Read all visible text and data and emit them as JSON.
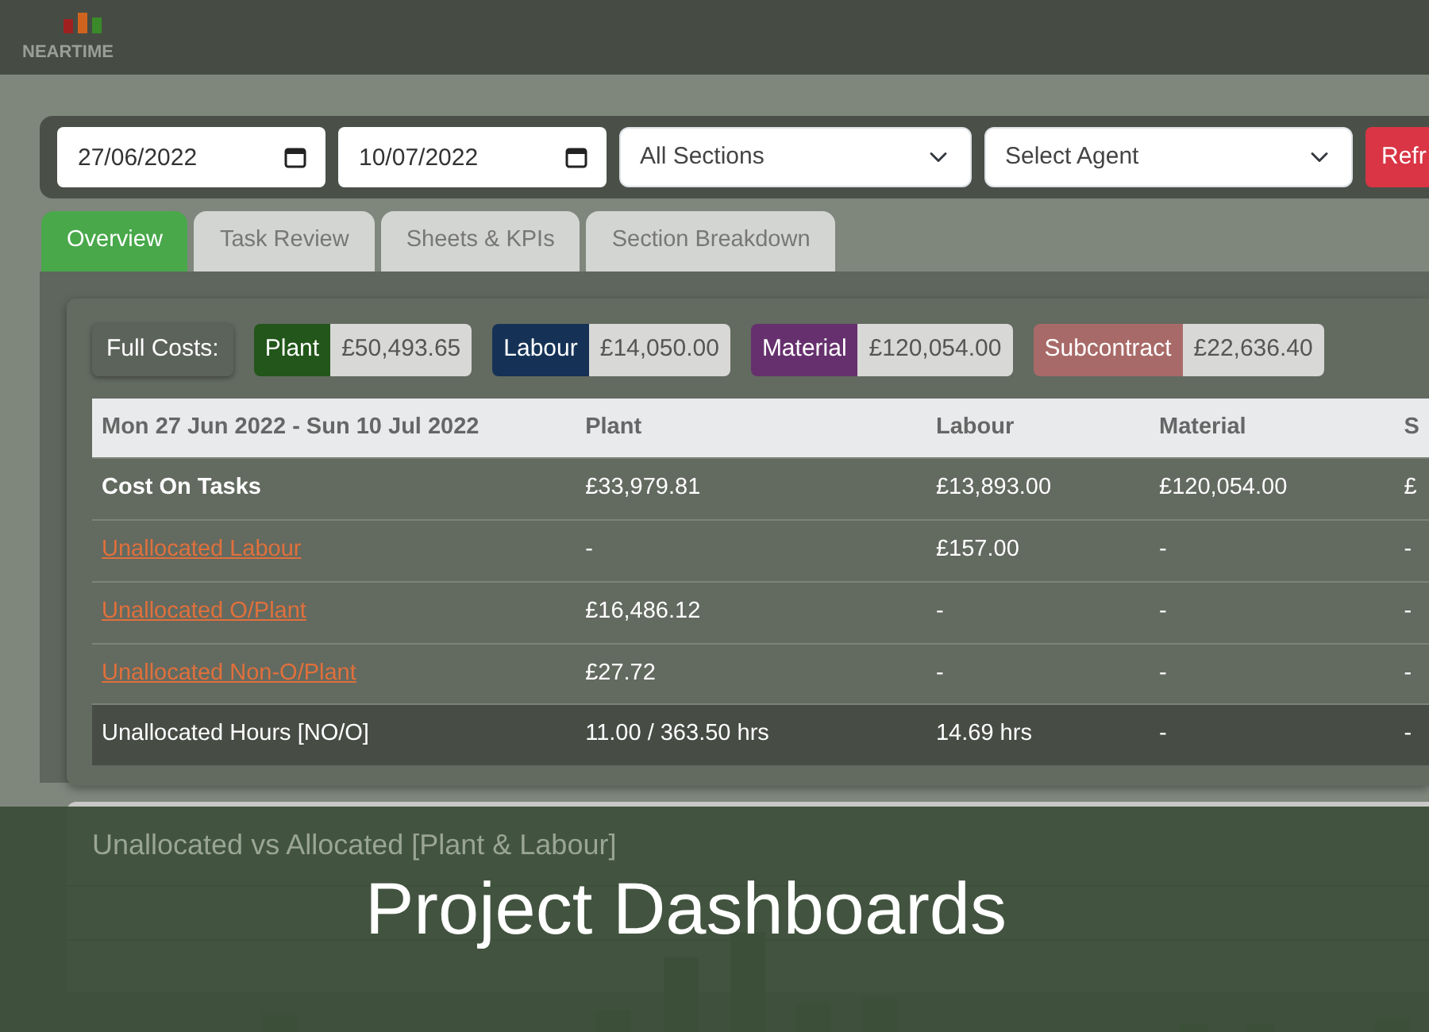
{
  "header": {
    "logo_text": "NEARTIME"
  },
  "filters": {
    "date_from": "27/06/2022",
    "date_to": "10/07/2022",
    "section": "All Sections",
    "agent": "Select Agent",
    "refresh_button": "Refr"
  },
  "tabs": [
    {
      "label": "Overview",
      "selected": true
    },
    {
      "label": "Task Review",
      "selected": false
    },
    {
      "label": "Sheets & KPIs",
      "selected": false
    },
    {
      "label": "Section Breakdown",
      "selected": false
    }
  ],
  "full_costs": {
    "label": "Full Costs:",
    "items": [
      {
        "name": "Plant",
        "amount": "£50,493.65",
        "color": "#22561a"
      },
      {
        "name": "Labour",
        "amount": "£14,050.00",
        "color": "#153256"
      },
      {
        "name": "Material",
        "amount": "£120,054.00",
        "color": "#66306e"
      },
      {
        "name": "Subcontract",
        "amount": "£22,636.40",
        "color": "#a86a68"
      }
    ]
  },
  "table": {
    "columns": [
      "Mon 27 Jun 2022 - Sun 10 Jul 2022",
      "Plant",
      "Labour",
      "Material",
      "S"
    ],
    "rows": [
      {
        "kind": "total",
        "cells": [
          "Cost On Tasks",
          "£33,979.81",
          "£13,893.00",
          "£120,054.00",
          "£"
        ]
      },
      {
        "kind": "link",
        "cells": [
          "Unallocated Labour",
          "-",
          "£157.00",
          "-",
          "-"
        ]
      },
      {
        "kind": "link",
        "cells": [
          "Unallocated O/Plant",
          "£16,486.12",
          "-",
          "-",
          "-"
        ]
      },
      {
        "kind": "link",
        "cells": [
          "Unallocated Non-O/Plant",
          "£27.72",
          "-",
          "-",
          "-"
        ]
      },
      {
        "kind": "summary",
        "cells": [
          "Unallocated Hours [NO/O]",
          "11.00 / 363.50 hrs",
          "14.69 hrs",
          "-",
          "-"
        ]
      }
    ]
  },
  "chart_panel": {
    "title": "Unallocated vs Allocated [Plant & Labour]"
  },
  "banner": {
    "title": "Project Dashboards"
  }
}
